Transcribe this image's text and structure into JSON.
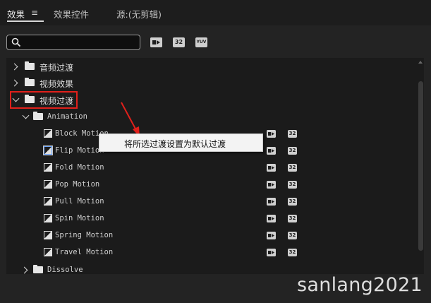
{
  "tabs": [
    {
      "label": "效果",
      "active": true
    },
    {
      "label": "效果控件",
      "active": false
    },
    {
      "label": "源:(无剪辑)",
      "active": false
    }
  ],
  "menu_icon": "≡",
  "search": {
    "value": "",
    "placeholder": ""
  },
  "toolbar_icons": [
    {
      "name": "accelerated-effects-icon",
      "text": ""
    },
    {
      "name": "32bit-color-icon",
      "text": "32"
    },
    {
      "name": "yuv-effects-icon",
      "text": "YUV"
    }
  ],
  "tree": {
    "audio_transitions": "音频过渡",
    "video_effects": "视频效果",
    "video_transitions": "视频过渡",
    "animation_folder": "Animation",
    "items": [
      "Block Motion",
      "Flip Motion",
      "Fold Motion",
      "Pop Motion",
      "Pull Motion",
      "Spin Motion",
      "Spring Motion",
      "Travel Motion"
    ],
    "dissolve_folder": "Dissolve",
    "badge_32": "32"
  },
  "context_menu": {
    "item": "将所选过渡设置为默认过渡"
  },
  "watermark": "sanlang2021",
  "colors": {
    "highlight": "#e0201b",
    "arrow": "#e0201b",
    "background": "#232323"
  }
}
